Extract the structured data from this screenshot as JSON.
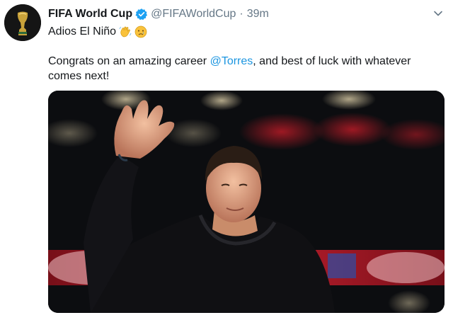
{
  "account": {
    "display_name": "FIFA World Cup",
    "handle": "@FIFAWorldCup",
    "separator": "·",
    "timestamp": "39m",
    "verified": true,
    "avatar_icon": "world-cup-trophy-icon"
  },
  "tweet": {
    "line1": "Adios El Niño",
    "line1_emojis": [
      "waving-hand-emoji",
      "crying-face-emoji"
    ],
    "text_before": "Congrats on an amazing career ",
    "mention": "@Torres",
    "text_after": ", and best of luck with whatever comes next!"
  },
  "media": {
    "type": "photo"
  },
  "colors": {
    "link": "#1b95e0",
    "verified": "#1da1f2",
    "secondary_text": "#657786",
    "primary_text": "#14171a"
  }
}
